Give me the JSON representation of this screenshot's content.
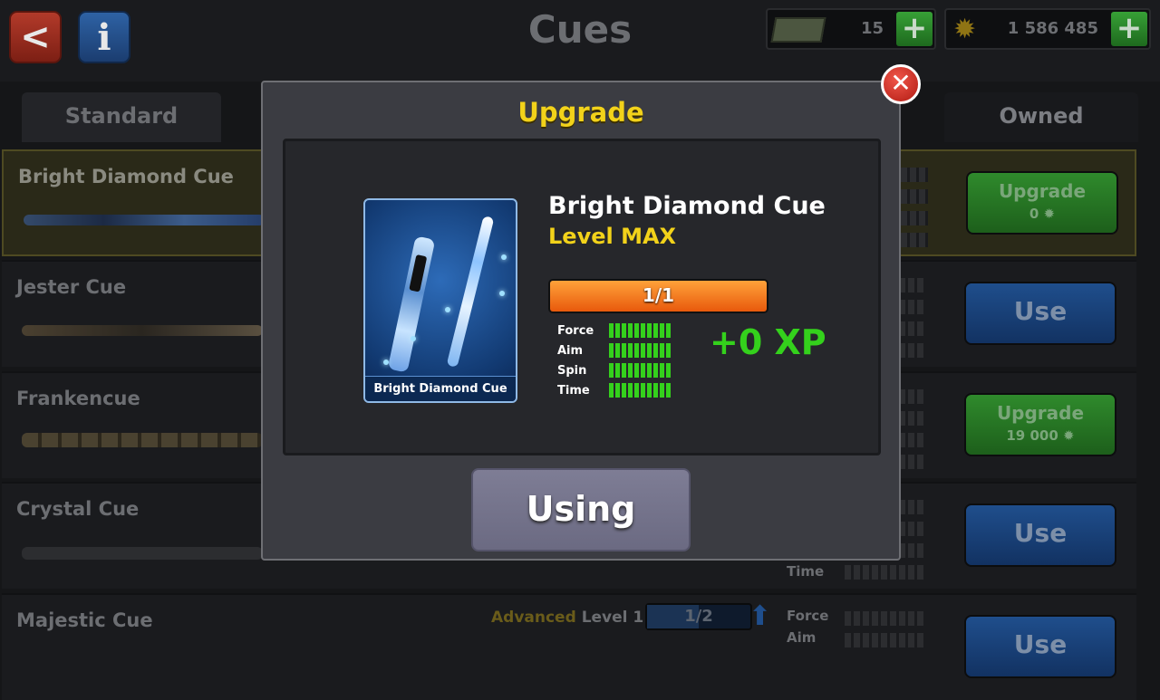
{
  "header": {
    "back_label": "<",
    "info_label": "i",
    "title": "Cues"
  },
  "currency": {
    "cash": "15",
    "coins": "1 586 485",
    "plus": "+"
  },
  "tabs": {
    "standard": "Standard",
    "owned": "Owned"
  },
  "rows": [
    {
      "name": "Bright Diamond Cue",
      "action": "Upgrade",
      "cost": "0"
    },
    {
      "name": "Jester Cue",
      "action": "Use"
    },
    {
      "name": "Frankencue",
      "action": "Upgrade",
      "cost": "19 000"
    },
    {
      "name": "Crystal Cue",
      "action": "Use",
      "stat_time": "Time"
    },
    {
      "name": "Majestic Cue",
      "action": "Use",
      "tier": "Advanced",
      "level": "Level 1",
      "progress": "1/2",
      "progress_fraction": 0.5,
      "stat_force": "Force",
      "stat_aim": "Aim"
    }
  ],
  "modal": {
    "title": "Upgrade",
    "close": "✕",
    "card_label": "Bright Diamond Cue",
    "cue_name": "Bright Diamond Cue",
    "cue_level": "Level MAX",
    "progress": "1/1",
    "progress_fraction": 1.0,
    "stats": [
      {
        "label": "Force",
        "value": 10,
        "max": 10
      },
      {
        "label": "Aim",
        "value": 10,
        "max": 10
      },
      {
        "label": "Spin",
        "value": 10,
        "max": 10
      },
      {
        "label": "Time",
        "value": 10,
        "max": 10
      }
    ],
    "xp": "+0 XP",
    "button": "Using"
  },
  "colors": {
    "title_yellow": "#f2d21a",
    "xp_green": "#34d11c",
    "progress_orange": "#f07a1e",
    "close_red": "#d6281c",
    "modal_bg": "#3b3c42"
  }
}
